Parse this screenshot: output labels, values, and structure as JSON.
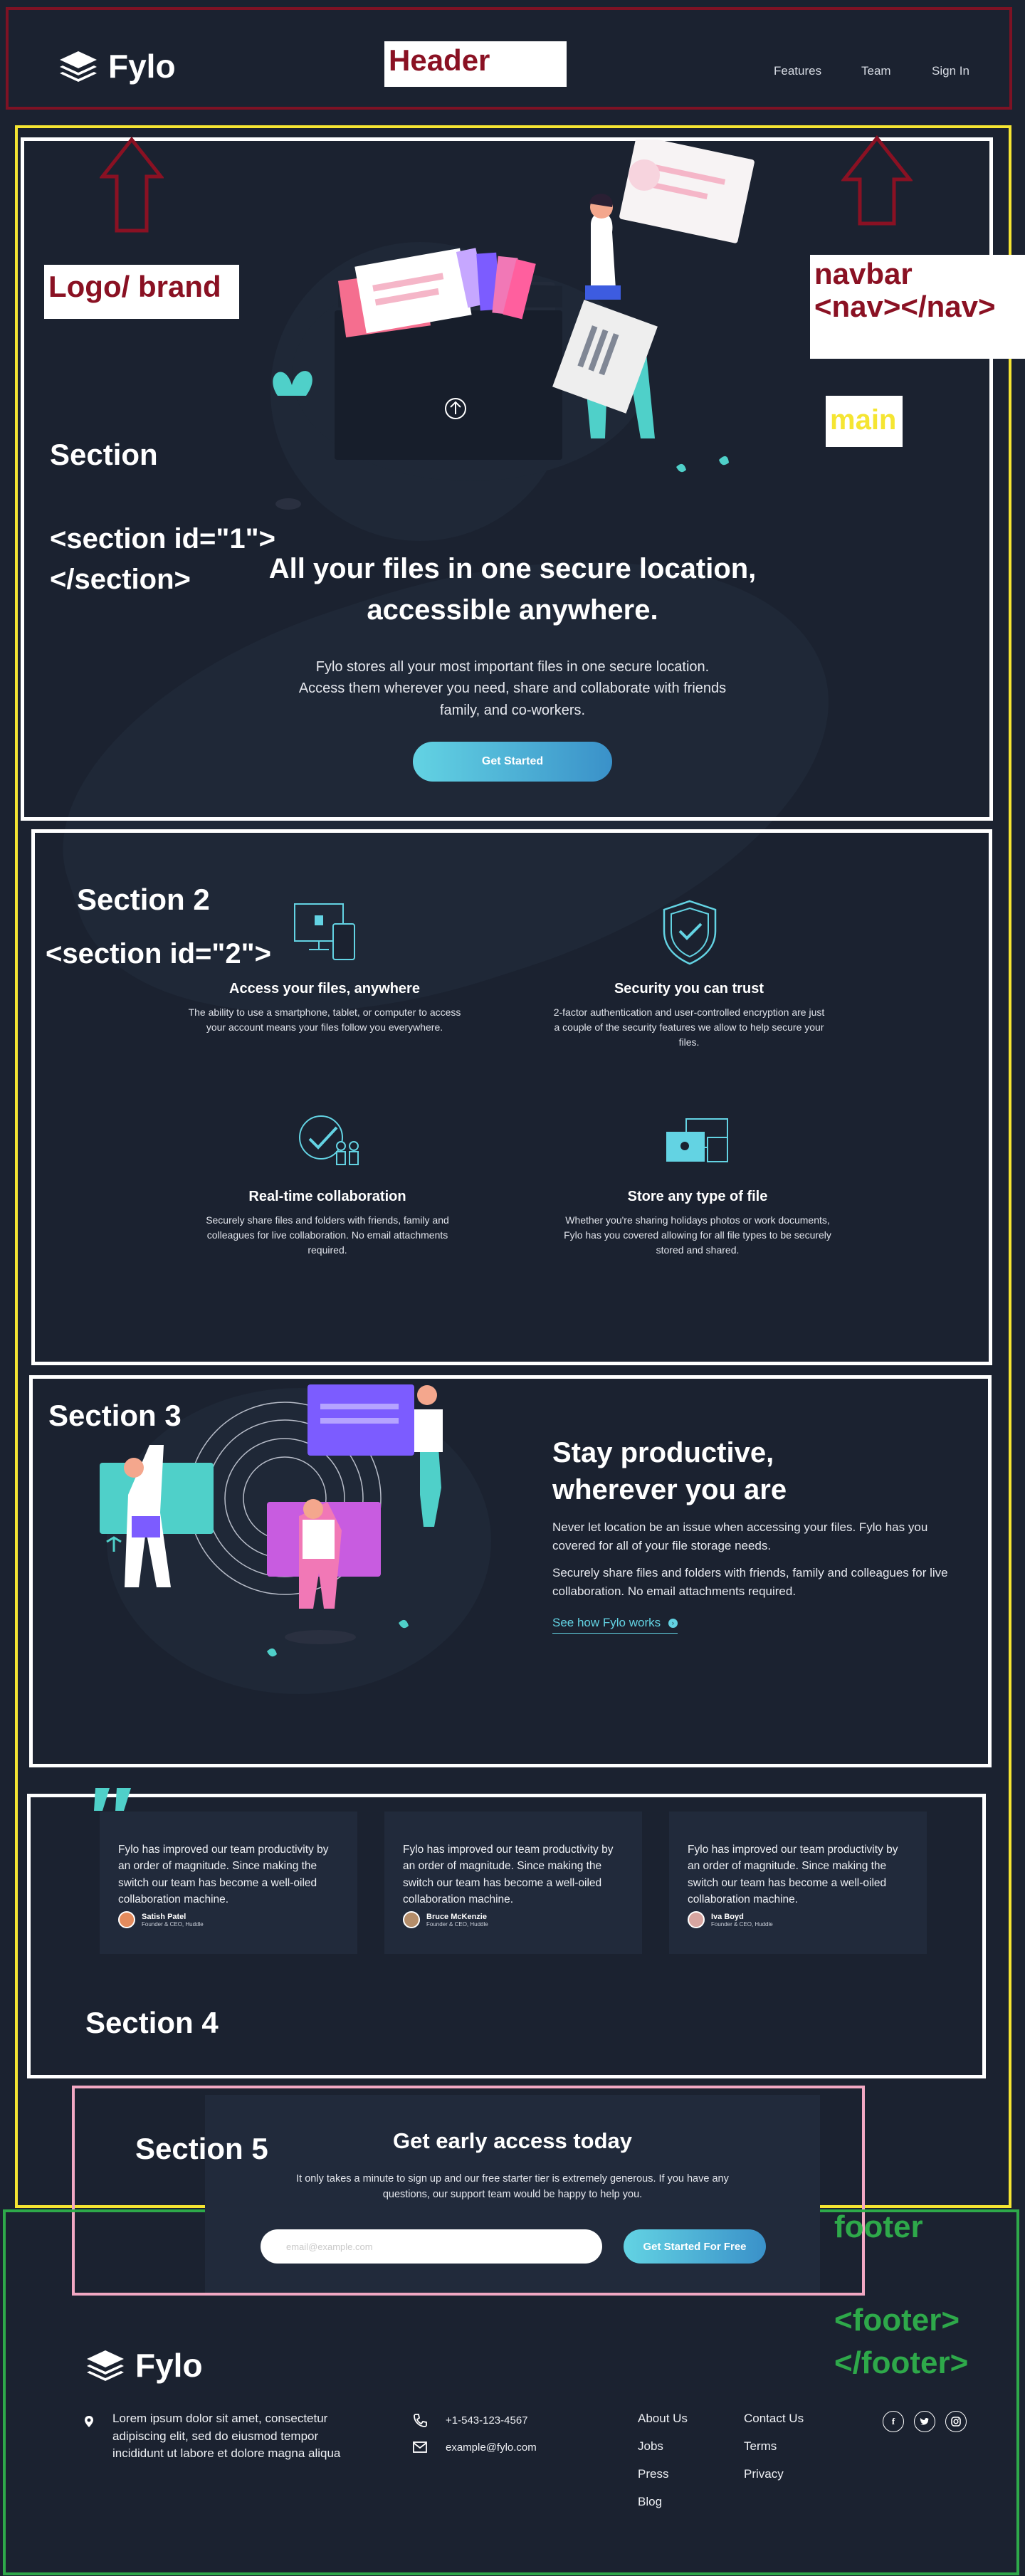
{
  "header": {
    "brand": "Fylo",
    "nav": [
      "Features",
      "Team",
      "Sign In"
    ]
  },
  "annotations": {
    "header": "Header",
    "logo": "Logo/ brand",
    "navbar_line1": "navbar",
    "navbar_line2": "<nav></nav>",
    "main": "main",
    "section1_name": "Section",
    "section1_tag_open": "<section id=\"1\">",
    "section1_tag_close": "</section>",
    "section2_name": "Section 2",
    "section2_tag": "<section id=\"2\">",
    "section3_name": "Section 3",
    "section4_name": "Section 4",
    "section5_name": "Section 5",
    "footer_name": "footer",
    "footer_tag_open": "<footer>",
    "footer_tag_close": "</footer>"
  },
  "hero": {
    "title_line1": "All your files in one secure location,",
    "title_line2": "accessible anywhere.",
    "text": "Fylo stores all your most important files in one secure location. Access them wherever you need, share and collaborate with friends family, and co-workers.",
    "cta": "Get Started"
  },
  "features": [
    {
      "title": "Access your files, anywhere",
      "text": "The ability to use a smartphone, tablet, or computer to access your account means your files follow you everywhere."
    },
    {
      "title": "Security you can trust",
      "text": "2-factor authentication and user-controlled encryption are just a couple of the security features we allow to help secure your files."
    },
    {
      "title": "Real-time collaboration",
      "text": "Securely share files and folders with friends, family and colleagues for live collaboration. No email attachments required."
    },
    {
      "title": "Store any type of file",
      "text": "Whether you're sharing holidays photos or work documents, Fylo has you covered allowing for all file types to be securely stored and shared."
    }
  ],
  "productive": {
    "title_line1": "Stay productive,",
    "title_line2": "wherever you are",
    "para1": "Never let location be an issue when accessing your files. Fylo has you covered for all of your file storage needs.",
    "para2": "Securely share files and folders with friends, family and colleagues for live collaboration. No email attachments required.",
    "link": "See how Fylo works"
  },
  "testimonials": [
    {
      "quote": "Fylo has improved our team productivity by an order of magnitude. Since making the switch our team has become a well-oiled collaboration machine.",
      "name": "Satish Patel",
      "role": "Founder & CEO, Huddle"
    },
    {
      "quote": "Fylo has improved our team productivity by an order of magnitude. Since making the switch our team has become a well-oiled collaboration machine.",
      "name": "Bruce McKenzie",
      "role": "Founder & CEO, Huddle"
    },
    {
      "quote": "Fylo has improved our team productivity by an order of magnitude. Since making the switch our team has become a well-oiled collaboration machine.",
      "name": "Iva Boyd",
      "role": "Founder & CEO, Huddle"
    }
  ],
  "early_access": {
    "title": "Get early access today",
    "text": "It only takes a minute to sign up and our free starter tier is extremely generous. If you have any questions, our support team would be happy to help you.",
    "email_placeholder": "email@example.com",
    "cta": "Get Started For Free"
  },
  "footer": {
    "brand": "Fylo",
    "address": "Lorem ipsum dolor sit amet, consectetur adipiscing elit, sed do eiusmod tempor incididunt ut labore et dolore magna aliqua",
    "phone": "+1-543-123-4567",
    "email": "example@fylo.com",
    "links_col1": [
      "About Us",
      "Jobs",
      "Press",
      "Blog"
    ],
    "links_col2": [
      "Contact Us",
      "Terms",
      "Privacy"
    ],
    "social": [
      "facebook-icon",
      "twitter-icon",
      "instagram-icon"
    ]
  },
  "colors": {
    "background": "#1b2230",
    "card": "#212a3b",
    "accent": "#63d3e3",
    "header_annotation": "#7e1224",
    "main_annotation": "#f5e532",
    "footer_annotation": "#2ea94a",
    "section5_annotation": "#f2a8c3"
  }
}
